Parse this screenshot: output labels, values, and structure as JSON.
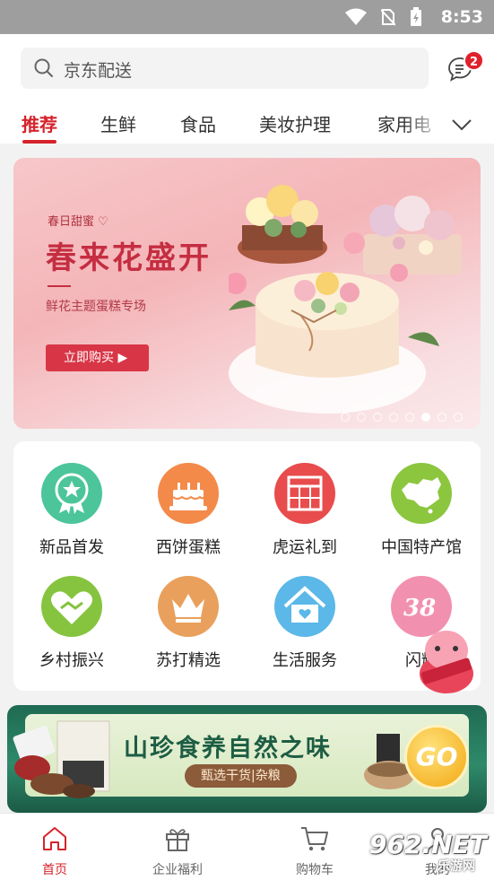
{
  "status_bar": {
    "time": "8:53"
  },
  "search": {
    "placeholder": "京东配送"
  },
  "messages": {
    "badge": "2"
  },
  "tabs": [
    {
      "label": "推荐",
      "active": true
    },
    {
      "label": "生鲜"
    },
    {
      "label": "食品"
    },
    {
      "label": "美妆护理"
    },
    {
      "label": "家用电"
    }
  ],
  "banner": {
    "subtitle": "春日甜蜜",
    "headline": "春来花盛开",
    "caption": "鲜花主题蛋糕专场",
    "cta": "立即购买",
    "page_count": 8,
    "active_page": 6
  },
  "categories": [
    {
      "label": "新品首发",
      "icon": "award-badge-icon",
      "color": "#4cc59b"
    },
    {
      "label": "西饼蛋糕",
      "icon": "cake-icon",
      "color": "#f38a4a"
    },
    {
      "label": "虎运礼到",
      "icon": "gift-calendar-icon",
      "color": "#e84c4c"
    },
    {
      "label": "中国特产馆",
      "icon": "china-map-icon",
      "color": "#8cc63f"
    },
    {
      "label": "乡村振兴",
      "icon": "handshake-heart-icon",
      "color": "#86c440"
    },
    {
      "label": "苏打精选",
      "icon": "crown-icon",
      "color": "#e9a05c"
    },
    {
      "label": "生活服务",
      "icon": "home-heart-icon",
      "color": "#5bb8e8"
    },
    {
      "label": "闪耀",
      "icon": "38-festival-icon",
      "color": "#f290b0"
    }
  ],
  "promo": {
    "title": "山珍食养自然之味",
    "chip": "甄选干货|杂粮",
    "go_label": "GO"
  },
  "bottom_nav": [
    {
      "label": "首页",
      "icon": "home-icon",
      "active": true
    },
    {
      "label": "企业福利",
      "icon": "gift-box-icon"
    },
    {
      "label": "购物车",
      "icon": "cart-icon"
    },
    {
      "label": "我的",
      "icon": "user-icon"
    }
  ],
  "watermark": {
    "main": "962.NET",
    "sub": "乐游网"
  },
  "colors": {
    "accent": "#d6232b",
    "banner_pink": "#f4b5b8",
    "promo_green": "#1f6a52"
  }
}
